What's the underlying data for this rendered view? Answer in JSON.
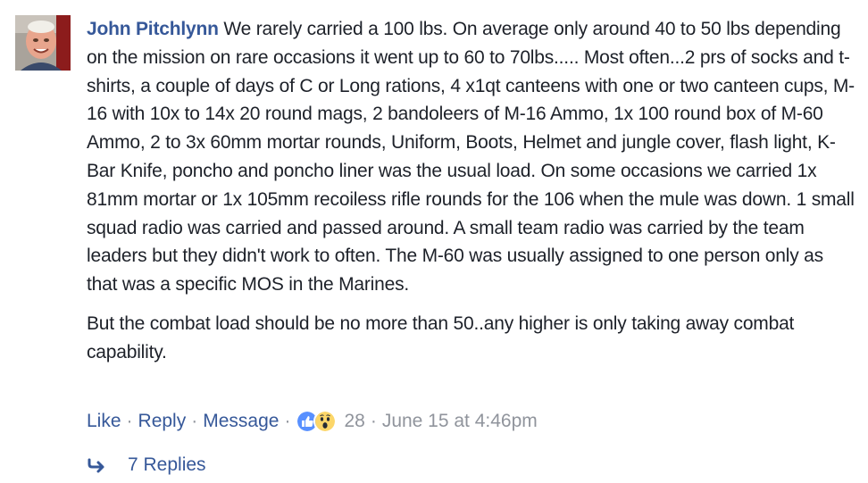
{
  "comment": {
    "author": "John Pitchlynn",
    "text": "We rarely carried a 100 lbs. On average only around 40 to 50 lbs depending on the mission on rare occasions it went up to 60 to 70lbs..... Most often...2 prs of socks and t-shirts, a couple of days of C or Long rations, 4 x1qt canteens with one or two canteen cups, M-16 with 10x to 14x 20 round mags, 2 bandoleers of M-16 Ammo, 1x 100 round box of M-60 Ammo, 2 to 3x 60mm mortar rounds, Uniform, Boots, Helmet and jungle cover, flash light, K-Bar Knife, poncho and poncho liner was the usual load. On some occasions we carried 1x 81mm mortar or 1x 105mm recoiless rifle rounds for the 106 when the mule was down. 1 small squad radio was carried and passed around. A small team radio was carried by the team leaders but they didn't work to often. The M-60 was usually assigned to one person only as that was a specific MOS in the Marines.",
    "text2": "But the combat load should be no more than 50..any higher is only taking away combat capability."
  },
  "actions": {
    "like": "Like",
    "reply": "Reply",
    "message": "Message",
    "separator": "·",
    "reaction_icons": [
      "like-reaction-icon",
      "wow-reaction-icon"
    ],
    "reaction_count": "28",
    "timestamp": "June 15 at 4:46pm"
  },
  "replies": {
    "label": "7 Replies"
  },
  "colors": {
    "link": "#365899",
    "text": "#1d2129",
    "meta": "#90949c",
    "like_blue": "#5890ff",
    "wow_yellow": "#fcd669"
  }
}
